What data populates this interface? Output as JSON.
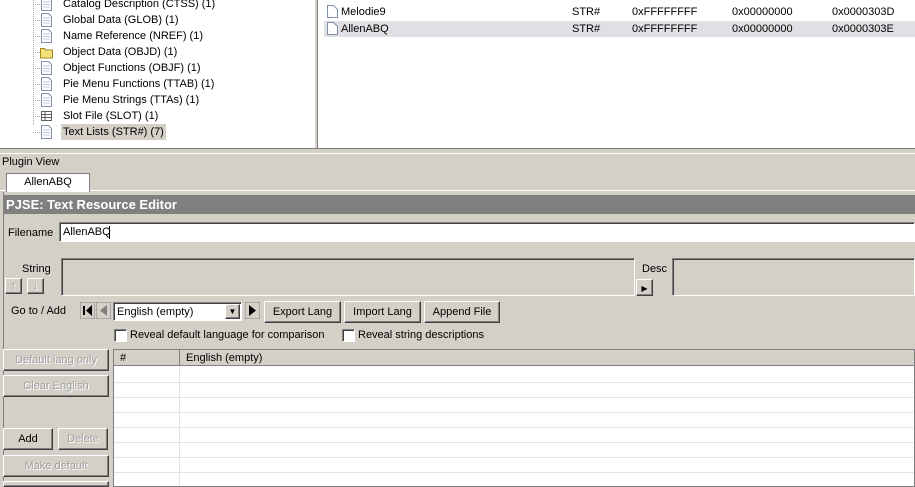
{
  "tree": {
    "items": [
      {
        "label": "Catalog Description (CTSS) (1)",
        "icon": "page-icon"
      },
      {
        "label": "Global Data (GLOB) (1)",
        "icon": "page-icon"
      },
      {
        "label": "Name Reference (NREF) (1)",
        "icon": "page-icon"
      },
      {
        "label": "Object Data (OBJD) (1)",
        "icon": "folder-icon"
      },
      {
        "label": "Object Functions (OBJF) (1)",
        "icon": "page-icon"
      },
      {
        "label": "Pie Menu Functions (TTAB) (1)",
        "icon": "page-icon"
      },
      {
        "label": "Pie Menu Strings (TTAs) (1)",
        "icon": "page-icon"
      },
      {
        "label": "Slot File (SLOT) (1)",
        "icon": "grid-icon"
      },
      {
        "label": "Text Lists (STR#) (7)",
        "icon": "page-icon",
        "selected": true
      }
    ]
  },
  "resource_list": {
    "rows": [
      {
        "name": "Melodie9",
        "type": "STR#",
        "group": "0xFFFFFFFF",
        "hi": "0x00000000",
        "inst": "0x0000303D"
      },
      {
        "name": "AllenABQ",
        "type": "STR#",
        "group": "0xFFFFFFFF",
        "hi": "0x00000000",
        "inst": "0x0000303E",
        "selected": true
      }
    ]
  },
  "plugin_view": {
    "header": "Plugin View",
    "tab_label": "AllenABQ",
    "title": "PJSE: Text Resource Editor",
    "filename_label": "Filename",
    "filename_value": "AllenABQ",
    "string_label": "String",
    "desc_label": "Desc",
    "goto_label": "Go to / Add",
    "language_selected": "English (empty)",
    "export_lang": "Export Lang",
    "import_lang": "Import Lang",
    "append_file": "Append File",
    "reveal_default": "Reveal default language for comparison",
    "reveal_desc": "Reveal string descriptions",
    "default_lang_only": "Default lang only",
    "clear_english": "Clear English",
    "add": "Add",
    "delete": "Delete",
    "make_default": "Make default",
    "grid_col_num": "#",
    "grid_col_lang": "English (empty)"
  }
}
